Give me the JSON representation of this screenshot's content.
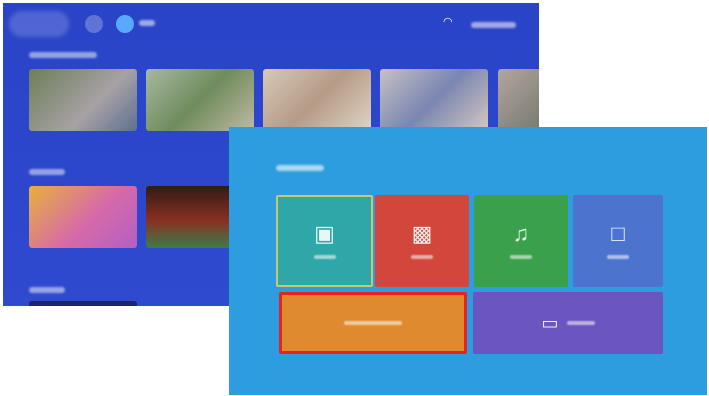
{
  "background_screen": {
    "colors": {
      "bg": "#2f49cf",
      "accent": "#58a8ff"
    },
    "topbar_icons": [
      "profile-icon",
      "search-icon",
      "wifi-icon"
    ],
    "thumbnail_rows": 3
  },
  "foreground_screen": {
    "colors": {
      "bg": "#2d9de0",
      "selection": "#e8231c"
    },
    "tiles": [
      {
        "icon": "video-icon",
        "color": "#2fa6a8"
      },
      {
        "icon": "photo-icon",
        "color": "#d3463c"
      },
      {
        "icon": "music-icon",
        "color": "#3aa04b"
      },
      {
        "icon": "file-icon",
        "color": "#4c74cf"
      },
      {
        "icon": "app-icon",
        "color": "#df8a2e"
      },
      {
        "icon": "screen-mirror-icon",
        "color": "#6b55c0"
      }
    ]
  }
}
